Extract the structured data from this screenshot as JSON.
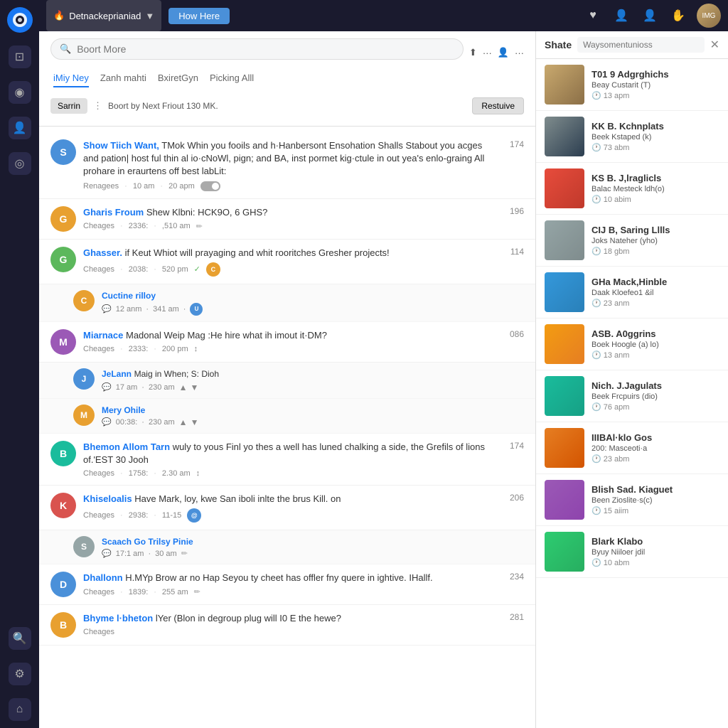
{
  "app": {
    "logo": "f",
    "nav_icons": [
      "⊡",
      "◉",
      "👤",
      "◎"
    ],
    "app_name": "Detnackeprianiad",
    "how_here_label": "How Here",
    "topbar_icons": [
      "♥",
      "👤",
      "👤",
      "✋"
    ],
    "user_avatar": "U"
  },
  "feed": {
    "search_placeholder": "Boort More",
    "tabs": [
      {
        "label": "iMiy Ney",
        "active": true
      },
      {
        "label": "Zanh mahti",
        "active": false
      },
      {
        "label": "BxiretGyn",
        "active": false
      },
      {
        "label": "Picking Alll",
        "active": false
      }
    ],
    "sort_btn": "Sarrin",
    "sort_info": "Boort by Next Friout 130 MK.",
    "resolve_btn": "Restuive",
    "posts": [
      {
        "id": 1,
        "author": "Show Tiich Want,",
        "text": "TMok Whin you fooils and h·Hanbersont Ensohation Shalls Stabout you acges and pation| host ful thin al io·cNoWl, pign; and BA, inst pormet kig·ctule in out yea's enlo-graing All prohare in eraurtens off best labLit:",
        "meta_label": "Renagees",
        "meta_time1": "10 am",
        "meta_time2": "20 apm",
        "has_toggle": true,
        "count": "174",
        "avatar_color": "av-blue",
        "avatar_letter": "S",
        "replies": []
      },
      {
        "id": 2,
        "author": "Gharis Froum",
        "text": "Shew Klbni: HCK9O, 6 GHS?",
        "meta_label": "Cheages",
        "meta_time1": "2336:",
        "meta_time2": ",510 am",
        "has_edit": true,
        "count": "196",
        "avatar_color": "av-orange",
        "avatar_letter": "G",
        "replies": []
      },
      {
        "id": 3,
        "author": "Ghasser.",
        "text": "if Keut Whiot will prayaging and whit rooritches Gresher projects!",
        "meta_label": "Cheages",
        "meta_time1": "2038:",
        "meta_time2": "520 pm",
        "has_check": true,
        "has_reply_avatar": true,
        "count": "114",
        "avatar_color": "av-green",
        "avatar_letter": "G",
        "replies": [
          {
            "author": "Cuctine rilloy",
            "text": "",
            "meta_time1": "12 anm",
            "meta_time2": "341 am",
            "avatar_color": "av-orange",
            "avatar_letter": "C"
          }
        ]
      },
      {
        "id": 4,
        "author": "Miarnace",
        "text": "Madonal Weip Mag :He hire what ih imout it·DM?",
        "meta_label": "Cheages",
        "meta_time1": "2333:",
        "meta_time2": "200 pm",
        "has_arrows": true,
        "count": "086",
        "avatar_color": "av-purple",
        "avatar_letter": "M",
        "replies": [
          {
            "author": "JeLann",
            "text": "Maig in When; S: Dioh",
            "meta_time1": "17 am",
            "meta_time2": "230 am",
            "avatar_color": "av-blue",
            "avatar_letter": "J"
          },
          {
            "author": "Mery Ohile",
            "text": "",
            "meta_time1": "00:38:",
            "meta_time2": "230 am",
            "avatar_color": "av-orange",
            "avatar_letter": "M"
          }
        ]
      },
      {
        "id": 5,
        "author": "Bhemon Allom Tarn",
        "text": "wuly to yous Finl yo thes a well has luned chalking a side, the Grefils of lions of.'EST 30 Jooh",
        "meta_label": "Cheages",
        "meta_time1": "1758:",
        "meta_time2": "2.30 am",
        "has_arrows": true,
        "count": "174",
        "avatar_color": "av-teal",
        "avatar_letter": "B",
        "replies": []
      },
      {
        "id": 6,
        "author": "Khiseloalis",
        "text": "Have Mark, loy, kwe San iboli inlte the brus Kill. on",
        "meta_label": "Cheages",
        "meta_time1": "2938:",
        "meta_time2": "11-15",
        "has_mention": true,
        "count": "206",
        "avatar_color": "av-red",
        "avatar_letter": "K",
        "replies": [
          {
            "author": "Scaach Go Trilsy Pinie",
            "text": "",
            "meta_time1": "17:1 am",
            "meta_time2": "30 am",
            "avatar_color": "av-gray",
            "avatar_letter": "S"
          }
        ]
      },
      {
        "id": 7,
        "author": "Dhallonn",
        "text": "H.MYp Brow ar no Hap Seyou ty cheet has offler fny quere in ightive. IHallf.",
        "meta_label": "Cheages",
        "meta_time1": "1839:",
        "meta_time2": "255 am",
        "has_edit": true,
        "count": "234",
        "avatar_color": "av-blue",
        "avatar_letter": "D",
        "replies": []
      },
      {
        "id": 8,
        "author": "Bhyme l·bheton",
        "text": "lYer (Blon in degroup plug will I0 E the hewe?",
        "meta_label": "Cheages",
        "meta_time1": "...",
        "meta_time2": "...",
        "count": "281",
        "avatar_color": "av-orange",
        "avatar_letter": "B",
        "replies": []
      }
    ]
  },
  "right_panel": {
    "title": "Shate",
    "search_placeholder": "Waysomentunioss",
    "items": [
      {
        "title": "T01 9 Adgrghichs",
        "sub": "Beay Custarit (T)",
        "time": "13 apm",
        "img_class": "img-p1"
      },
      {
        "title": "KK B. Kchnplats",
        "sub": "Beek Kstaped (k)",
        "time": "73 abm",
        "img_class": "img-p2"
      },
      {
        "title": "KS B. J,lraglicls",
        "sub": "Balac Mesteck ldh(o)",
        "time": "10 abim",
        "img_class": "img-p3"
      },
      {
        "title": "CIJ B, Saring Lllls",
        "sub": "Joks Nateher (yho)",
        "time": "18 gbm",
        "img_class": "img-p4"
      },
      {
        "title": "GHa Mack,Hinble",
        "sub": "Daak Kloefeo1 &il",
        "time": "23 anm",
        "img_class": "img-p5"
      },
      {
        "title": "ASB. A0ggrins",
        "sub": "Boek Hoogle (a) lo)",
        "time": "13 anm",
        "img_class": "img-p6"
      },
      {
        "title": "Nich. J.Jagulats",
        "sub": "Beek Frcpuirs (dio)",
        "time": "76 apm",
        "img_class": "img-p7"
      },
      {
        "title": "IIIBAl·klo Gos",
        "sub": "200: Masceoti·a",
        "time": "23 abm",
        "img_class": "img-p8"
      },
      {
        "title": "Blish Sad. Kiaguet",
        "sub": "Been Zioslite·s(c)",
        "time": "15 aiim",
        "img_class": "img-p9"
      },
      {
        "title": "Blark Klabo",
        "sub": "Byuy Niiloer jdil",
        "time": "10 abm",
        "img_class": "img-p10"
      }
    ]
  }
}
